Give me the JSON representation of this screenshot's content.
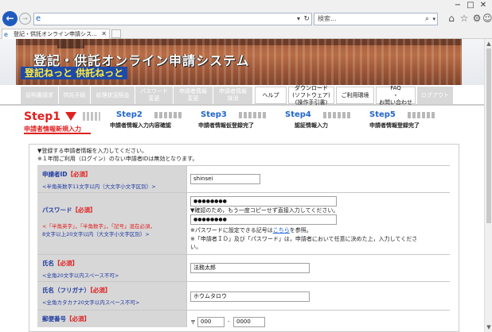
{
  "browser": {
    "tab_title": "登記・供託オンライン申請シス...",
    "search_placeholder": "検索...",
    "minimize_glyph": "−",
    "maximize_glyph": "□",
    "close_glyph": "✕"
  },
  "banner": {
    "title": "登記・供託オンライン申請システム",
    "subtitle": "登記ねっと 供託ねっと"
  },
  "nav": {
    "items": [
      {
        "label": "証明書請求",
        "active": false
      },
      {
        "label": "供託手続",
        "active": false
      },
      {
        "label": "処理状況照会",
        "active": false
      },
      {
        "label": "パスワード\n変更",
        "active": false
      },
      {
        "label": "申請者情報\n変更",
        "active": false
      },
      {
        "label": "申請者情報\n抹消",
        "active": false
      },
      {
        "label": "ヘルプ",
        "active": true
      },
      {
        "label": "ダウンロード\n(ソフトウェア)\n(操作手引書)",
        "active": true
      },
      {
        "label": "ご利用環境",
        "active": true
      },
      {
        "label": "FAQ\n・\nお問い合わせ",
        "active": true
      },
      {
        "label": "ログアウト",
        "active": false
      }
    ]
  },
  "steps": {
    "step1": {
      "num": "Step1",
      "label": "申請者情報新規入力"
    },
    "step2": {
      "num": "Step2",
      "label": "申請者情報入力内容確認"
    },
    "step3": {
      "num": "Step3",
      "label": "申請者情報仮登録完了"
    },
    "step4": {
      "num": "Step4",
      "label": "認証情報入力"
    },
    "step5": {
      "num": "Step5",
      "label": "申請者情報登録完了"
    }
  },
  "form": {
    "intro1": "▼登録する申請者情報を入力してください。",
    "intro2": "※１年間ご利用（ログイン）のない申請者IDは無効となります。",
    "required": "【必須】",
    "applicant_id": {
      "label": "申請者ID",
      "note": "<半角英数字11文字以内（大文字小文字区別）>",
      "value": "shinsei"
    },
    "password": {
      "label": "パスワード",
      "note1": "<「半角英字」，「半角数字」，「記号」混在必須，",
      "note2": "8文字以上20文字以内（大文字小文字区別）>",
      "value1": "●●●●●●●●",
      "confirm_note": "▼確認のため，もう一度コピーせず直接入力してください。",
      "value2": "●●●●●●●●",
      "symbol_note_pre": "※パスワードに設定できる記号は",
      "symbol_link": "こちら",
      "symbol_note_post": "を参照。",
      "id_note1": "※「申請者ＩＤ」及び「パスワード」は，申請者において任意に決めた上，入力してくださ",
      "id_note2": "い。"
    },
    "name": {
      "label": "氏名",
      "note": "<全角20文字以内スペース不可>",
      "value": "法務太郎"
    },
    "kana": {
      "label": "氏名（フリガナ）",
      "note": "<全角カタカナ20文字以内スペース不可>",
      "value": "ホウムタロウ"
    },
    "postal": {
      "label": "郵便番号",
      "mark": "〒",
      "value1": "000",
      "dash": "-",
      "value2": "0000"
    }
  }
}
